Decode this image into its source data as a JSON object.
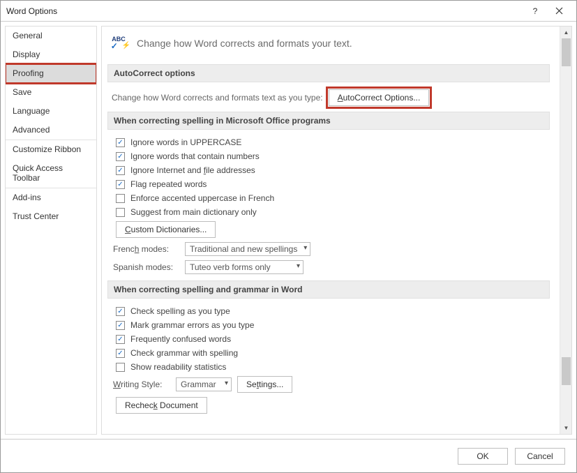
{
  "title": "Word Options",
  "header_text": "Change how Word corrects and formats your text.",
  "sidebar": {
    "items": [
      {
        "label": "General"
      },
      {
        "label": "Display"
      },
      {
        "label": "Proofing"
      },
      {
        "label": "Save"
      },
      {
        "label": "Language"
      },
      {
        "label": "Advanced"
      },
      {
        "label": "Customize Ribbon"
      },
      {
        "label": "Quick Access Toolbar"
      },
      {
        "label": "Add-ins"
      },
      {
        "label": "Trust Center"
      }
    ],
    "selected_index": 2
  },
  "sections": {
    "autocorrect": {
      "head": "AutoCorrect options",
      "desc": "Change how Word corrects and formats text as you type:",
      "button": "AutoCorrect Options..."
    },
    "spelling_office": {
      "head": "When correcting spelling in Microsoft Office programs",
      "checks": [
        {
          "checked": true,
          "label": "Ignore words in UPPERCASE"
        },
        {
          "checked": true,
          "label": "Ignore words that contain numbers"
        },
        {
          "checked": true,
          "label": "Ignore Internet and file addresses"
        },
        {
          "checked": true,
          "label": "Flag repeated words"
        },
        {
          "checked": false,
          "label": "Enforce accented uppercase in French"
        },
        {
          "checked": false,
          "label": "Suggest from main dictionary only"
        }
      ],
      "custom_dict_btn": "Custom Dictionaries...",
      "french_label": "French modes:",
      "french_value": "Traditional and new spellings",
      "spanish_label": "Spanish modes:",
      "spanish_value": "Tuteo verb forms only"
    },
    "spelling_word": {
      "head": "When correcting spelling and grammar in Word",
      "checks": [
        {
          "checked": true,
          "label": "Check spelling as you type"
        },
        {
          "checked": true,
          "label": "Mark grammar errors as you type"
        },
        {
          "checked": true,
          "label": "Frequently confused words"
        },
        {
          "checked": true,
          "label": "Check grammar with spelling"
        },
        {
          "checked": false,
          "label": "Show readability statistics"
        }
      ],
      "writing_style_label": "Writing Style:",
      "writing_style_value": "Grammar",
      "settings_btn": "Settings...",
      "recheck_btn": "Recheck Document"
    }
  },
  "footer": {
    "ok": "OK",
    "cancel": "Cancel"
  }
}
